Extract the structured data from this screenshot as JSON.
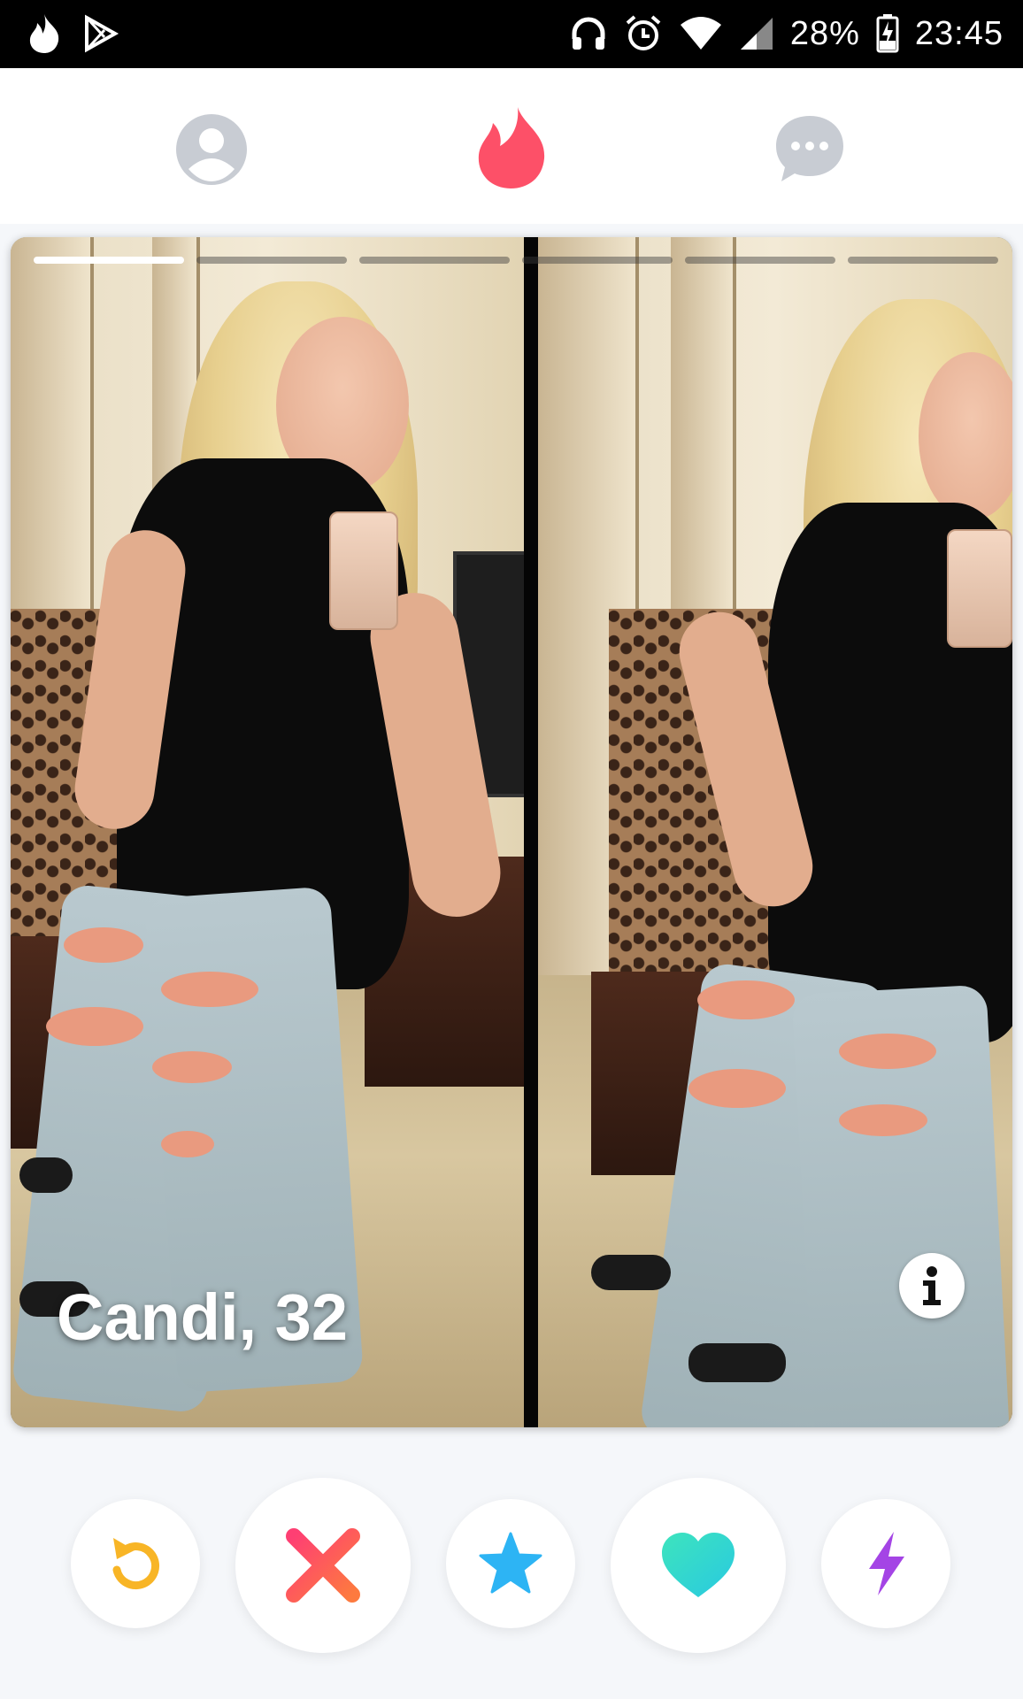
{
  "status_bar": {
    "battery": "28%",
    "time": "23:45",
    "icons": [
      "tinder-flame-icon",
      "play-store-icon",
      "headphones-icon",
      "alarm-icon",
      "wifi-icon",
      "signal-icon",
      "battery-charging-icon"
    ]
  },
  "top_nav": {
    "items": [
      {
        "name": "profile",
        "icon": "profile-icon"
      },
      {
        "name": "discover",
        "icon": "flame-icon",
        "active": true
      },
      {
        "name": "messages",
        "icon": "chat-icon"
      }
    ]
  },
  "card": {
    "name_age": "Candi, 32",
    "photo_count": 6,
    "current_photo": 1
  },
  "actions": [
    {
      "name": "rewind",
      "icon": "rewind-icon",
      "color": "#f8b526"
    },
    {
      "name": "nope",
      "icon": "close-icon",
      "color": "#fd4f5f"
    },
    {
      "name": "super-like",
      "icon": "star-icon",
      "color": "#2db4f4"
    },
    {
      "name": "like",
      "icon": "heart-icon",
      "color": "#35e1c1"
    },
    {
      "name": "boost",
      "icon": "lightning-icon",
      "color": "#a444e5"
    }
  ],
  "colors": {
    "brand": "#fd5068",
    "nav_inactive": "#c8ccd3"
  }
}
